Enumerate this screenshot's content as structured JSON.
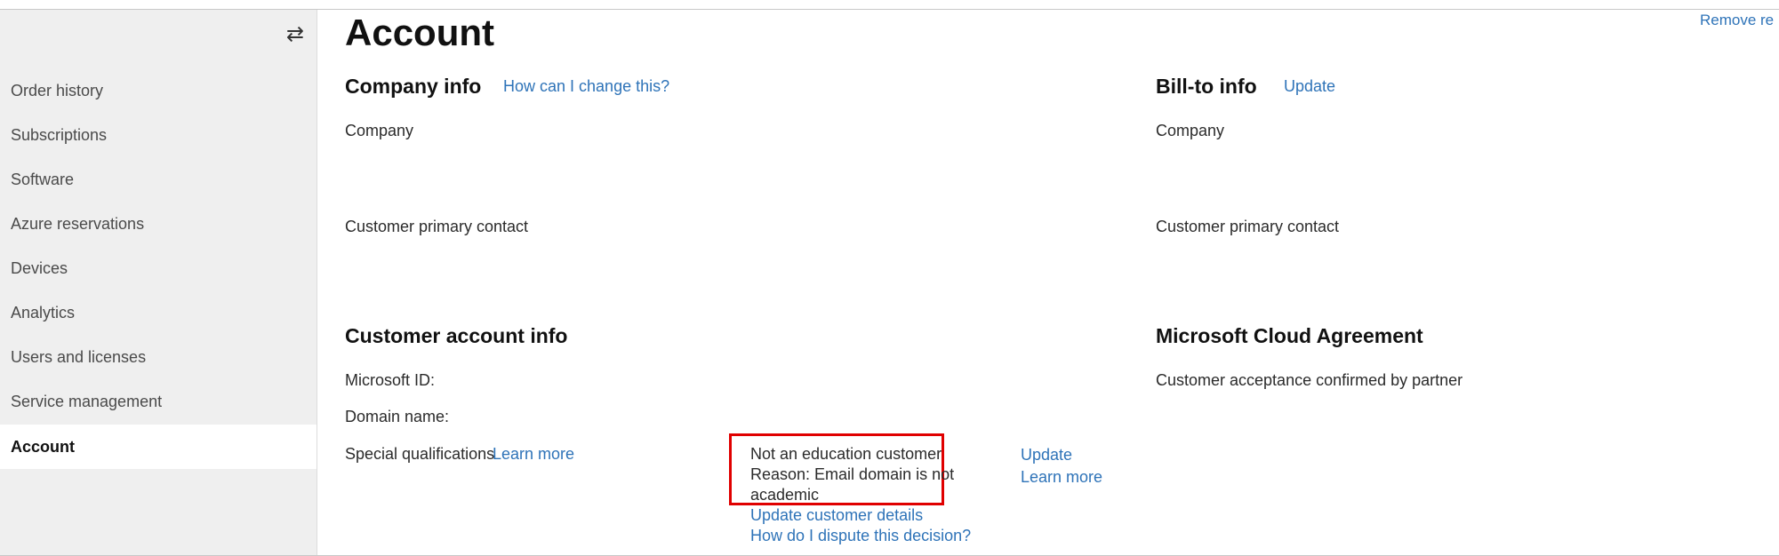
{
  "sidebar": {
    "items": [
      {
        "label": "Order history"
      },
      {
        "label": "Subscriptions"
      },
      {
        "label": "Software"
      },
      {
        "label": "Azure reservations"
      },
      {
        "label": "Devices"
      },
      {
        "label": "Analytics"
      },
      {
        "label": "Users and licenses"
      },
      {
        "label": "Service management"
      },
      {
        "label": "Account",
        "active": true
      }
    ]
  },
  "page": {
    "title": "Account",
    "remove_link": "Remove re"
  },
  "company_info": {
    "title": "Company info",
    "help_link": "How can I change this?",
    "company_label": "Company",
    "contact_label": "Customer primary contact"
  },
  "bill_to": {
    "title": "Bill-to info",
    "update_link": "Update",
    "company_label": "Company",
    "contact_label": "Customer primary contact"
  },
  "customer_account": {
    "title": "Customer account info",
    "microsoft_id_label": "Microsoft ID:",
    "domain_label": "Domain name:",
    "special_label": "Special qualifications",
    "special_learn_more": "Learn more",
    "status_line1": "Not an education customer",
    "status_line2": "Reason: Email domain is not",
    "status_line3": "academic",
    "update_link": "Update",
    "learn_more_link": "Learn more",
    "update_details_link": "Update customer details",
    "dispute_link": "How do I dispute this decision?"
  },
  "agreement": {
    "title": "Microsoft Cloud Agreement",
    "status": "Customer acceptance confirmed by partner"
  },
  "colors": {
    "link": "#2e73b8",
    "highlight_border": "#e00000",
    "sidebar_bg": "#efefef"
  },
  "icons": {
    "collapse": "swap-arrows-icon"
  }
}
